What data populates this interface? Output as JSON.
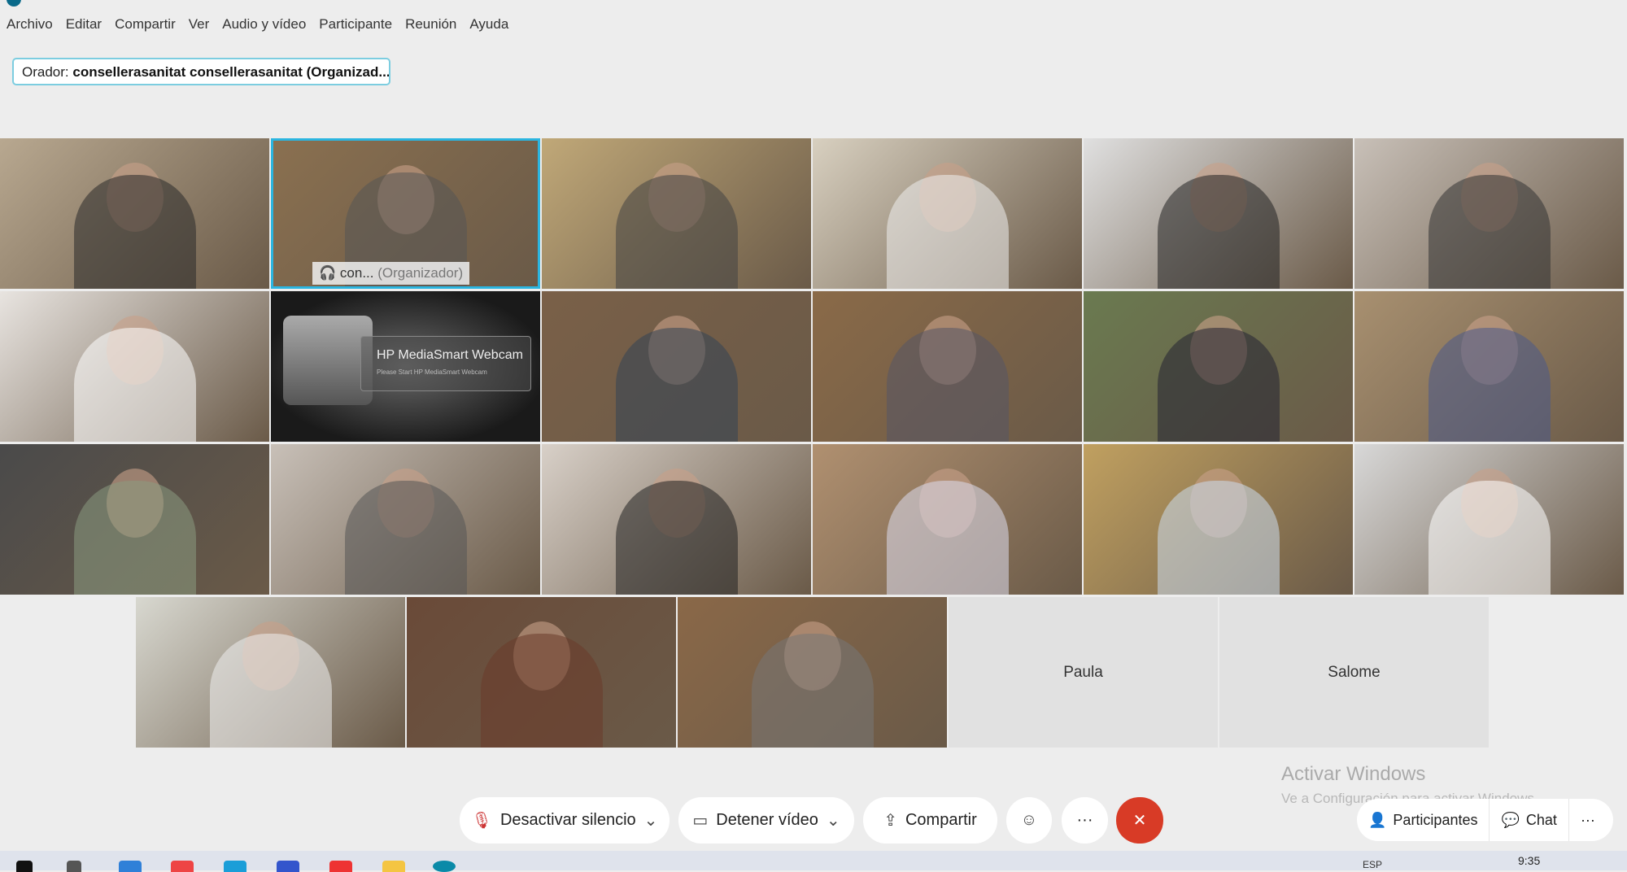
{
  "menu": [
    "Archivo",
    "Editar",
    "Compartir",
    "Ver",
    "Audio y vídeo",
    "Participante",
    "Reunión",
    "Ayuda"
  ],
  "orador": {
    "label": "Orador:",
    "name": "consellerasanitat consellerasanitat (Organizad..."
  },
  "organizer_tile": {
    "name": "con...",
    "role": "(Organizador)"
  },
  "hp_tile": {
    "title": "HP MediaSmart Webcam",
    "subtitle": "Please Start HP MediaSmart Webcam"
  },
  "name_tiles": [
    "Paula",
    "Salome"
  ],
  "toolbar": {
    "mute": "Desactivar silencio",
    "video": "Detener vídeo",
    "share": "Compartir",
    "more": "···",
    "end": "✕"
  },
  "right_panel": {
    "participants": "Participantes",
    "chat": "Chat",
    "more": "···"
  },
  "watermark": {
    "title": "Activar Windows",
    "subtitle": "Ve a Configuración para activar Windows."
  },
  "taskbar": {
    "time": "9:35",
    "lang": "ESP"
  },
  "colors": {
    "accent": "#2bb5e0",
    "end_call": "#d83b26"
  }
}
